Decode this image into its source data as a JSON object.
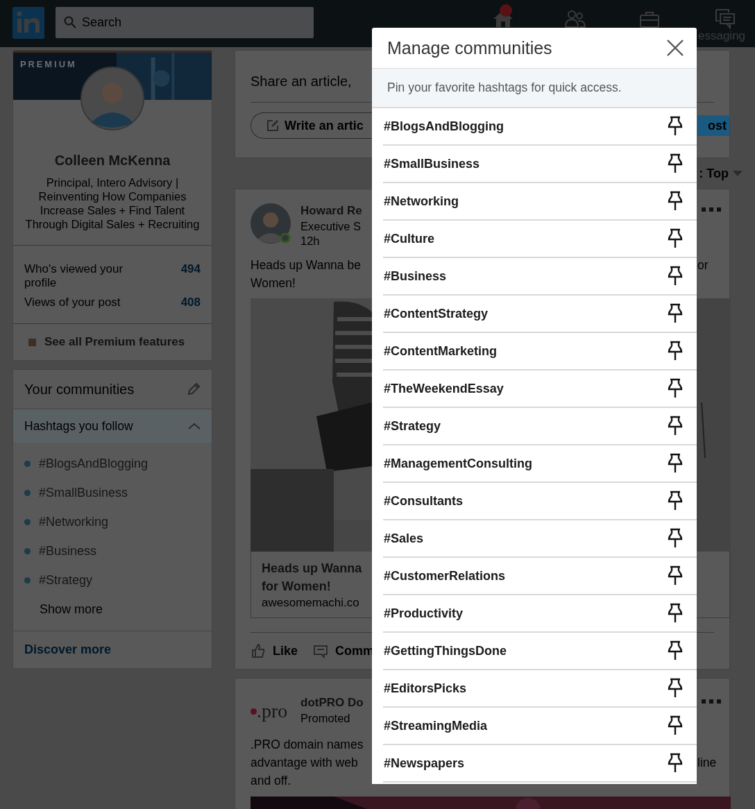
{
  "header": {
    "search_placeholder": "Search",
    "nav": [
      {
        "kind": "home",
        "badge": true
      },
      {
        "kind": "network",
        "badge": false
      },
      {
        "kind": "jobs",
        "badge": false
      },
      {
        "kind": "messaging",
        "badge": false,
        "label": "essaging"
      }
    ]
  },
  "profile": {
    "banner_label": "PREMIUM",
    "name": "Colleen McKenna",
    "headline": "Principal, Intero Advisory | Reinventing How Companies Increase Sales + Find Talent Through Digital Sales + Recruiting",
    "stats": [
      {
        "label": "Who's viewed your profile",
        "value": "494"
      },
      {
        "label": "Views of your post",
        "value": "408"
      }
    ],
    "premium_link": "See all Premium features"
  },
  "communities": {
    "title": "Your communities",
    "section": {
      "title": "Hashtags you follow",
      "expanded": true
    },
    "hashtags": [
      "#BlogsAndBlogging",
      "#SmallBusiness",
      "#Networking",
      "#Business",
      "#Strategy"
    ],
    "show_more": "Show more",
    "discover": "Discover more"
  },
  "feed": {
    "share": {
      "prompt": "Share an article,",
      "write_button": "Write an artic",
      "post_button": "ost"
    },
    "sort": ": Top",
    "post": {
      "author": "Howard Re",
      "subtitle": "Executive S",
      "time": "12h",
      "lines": [
        {
          "left": "Heads up Wanna be",
          "right": "or"
        },
        {
          "left": "Women!"
        }
      ],
      "preview_lines": [
        "Heads up Wanna",
        "for Women!"
      ],
      "preview_source": "awesomemachi.co",
      "actions": [
        {
          "kind": "like",
          "label": "Like"
        },
        {
          "kind": "comment",
          "label": "Comm"
        }
      ]
    },
    "promoted": {
      "logo_text": ".pro",
      "author": "dotPRO Do",
      "subtitle": "Promoted",
      "lines": [
        {
          "left": ".PRO domain names"
        },
        {
          "left": "advantage with web",
          "right": "line"
        },
        {
          "left": "and off."
        }
      ]
    }
  },
  "modal": {
    "title": "Manage communities",
    "hint": "Pin your favorite hashtags for quick access.",
    "hashtags": [
      "#BlogsAndBlogging",
      "#SmallBusiness",
      "#Networking",
      "#Culture",
      "#Business",
      "#ContentStrategy",
      "#ContentMarketing",
      "#TheWeekendEssay",
      "#Strategy",
      "#ManagementConsulting",
      "#Consultants",
      "#Sales",
      "#CustomerRelations",
      "#Productivity",
      "#GettingThingsDone",
      "#EditorsPicks",
      "#StreamingMedia",
      "#Newspapers"
    ]
  }
}
